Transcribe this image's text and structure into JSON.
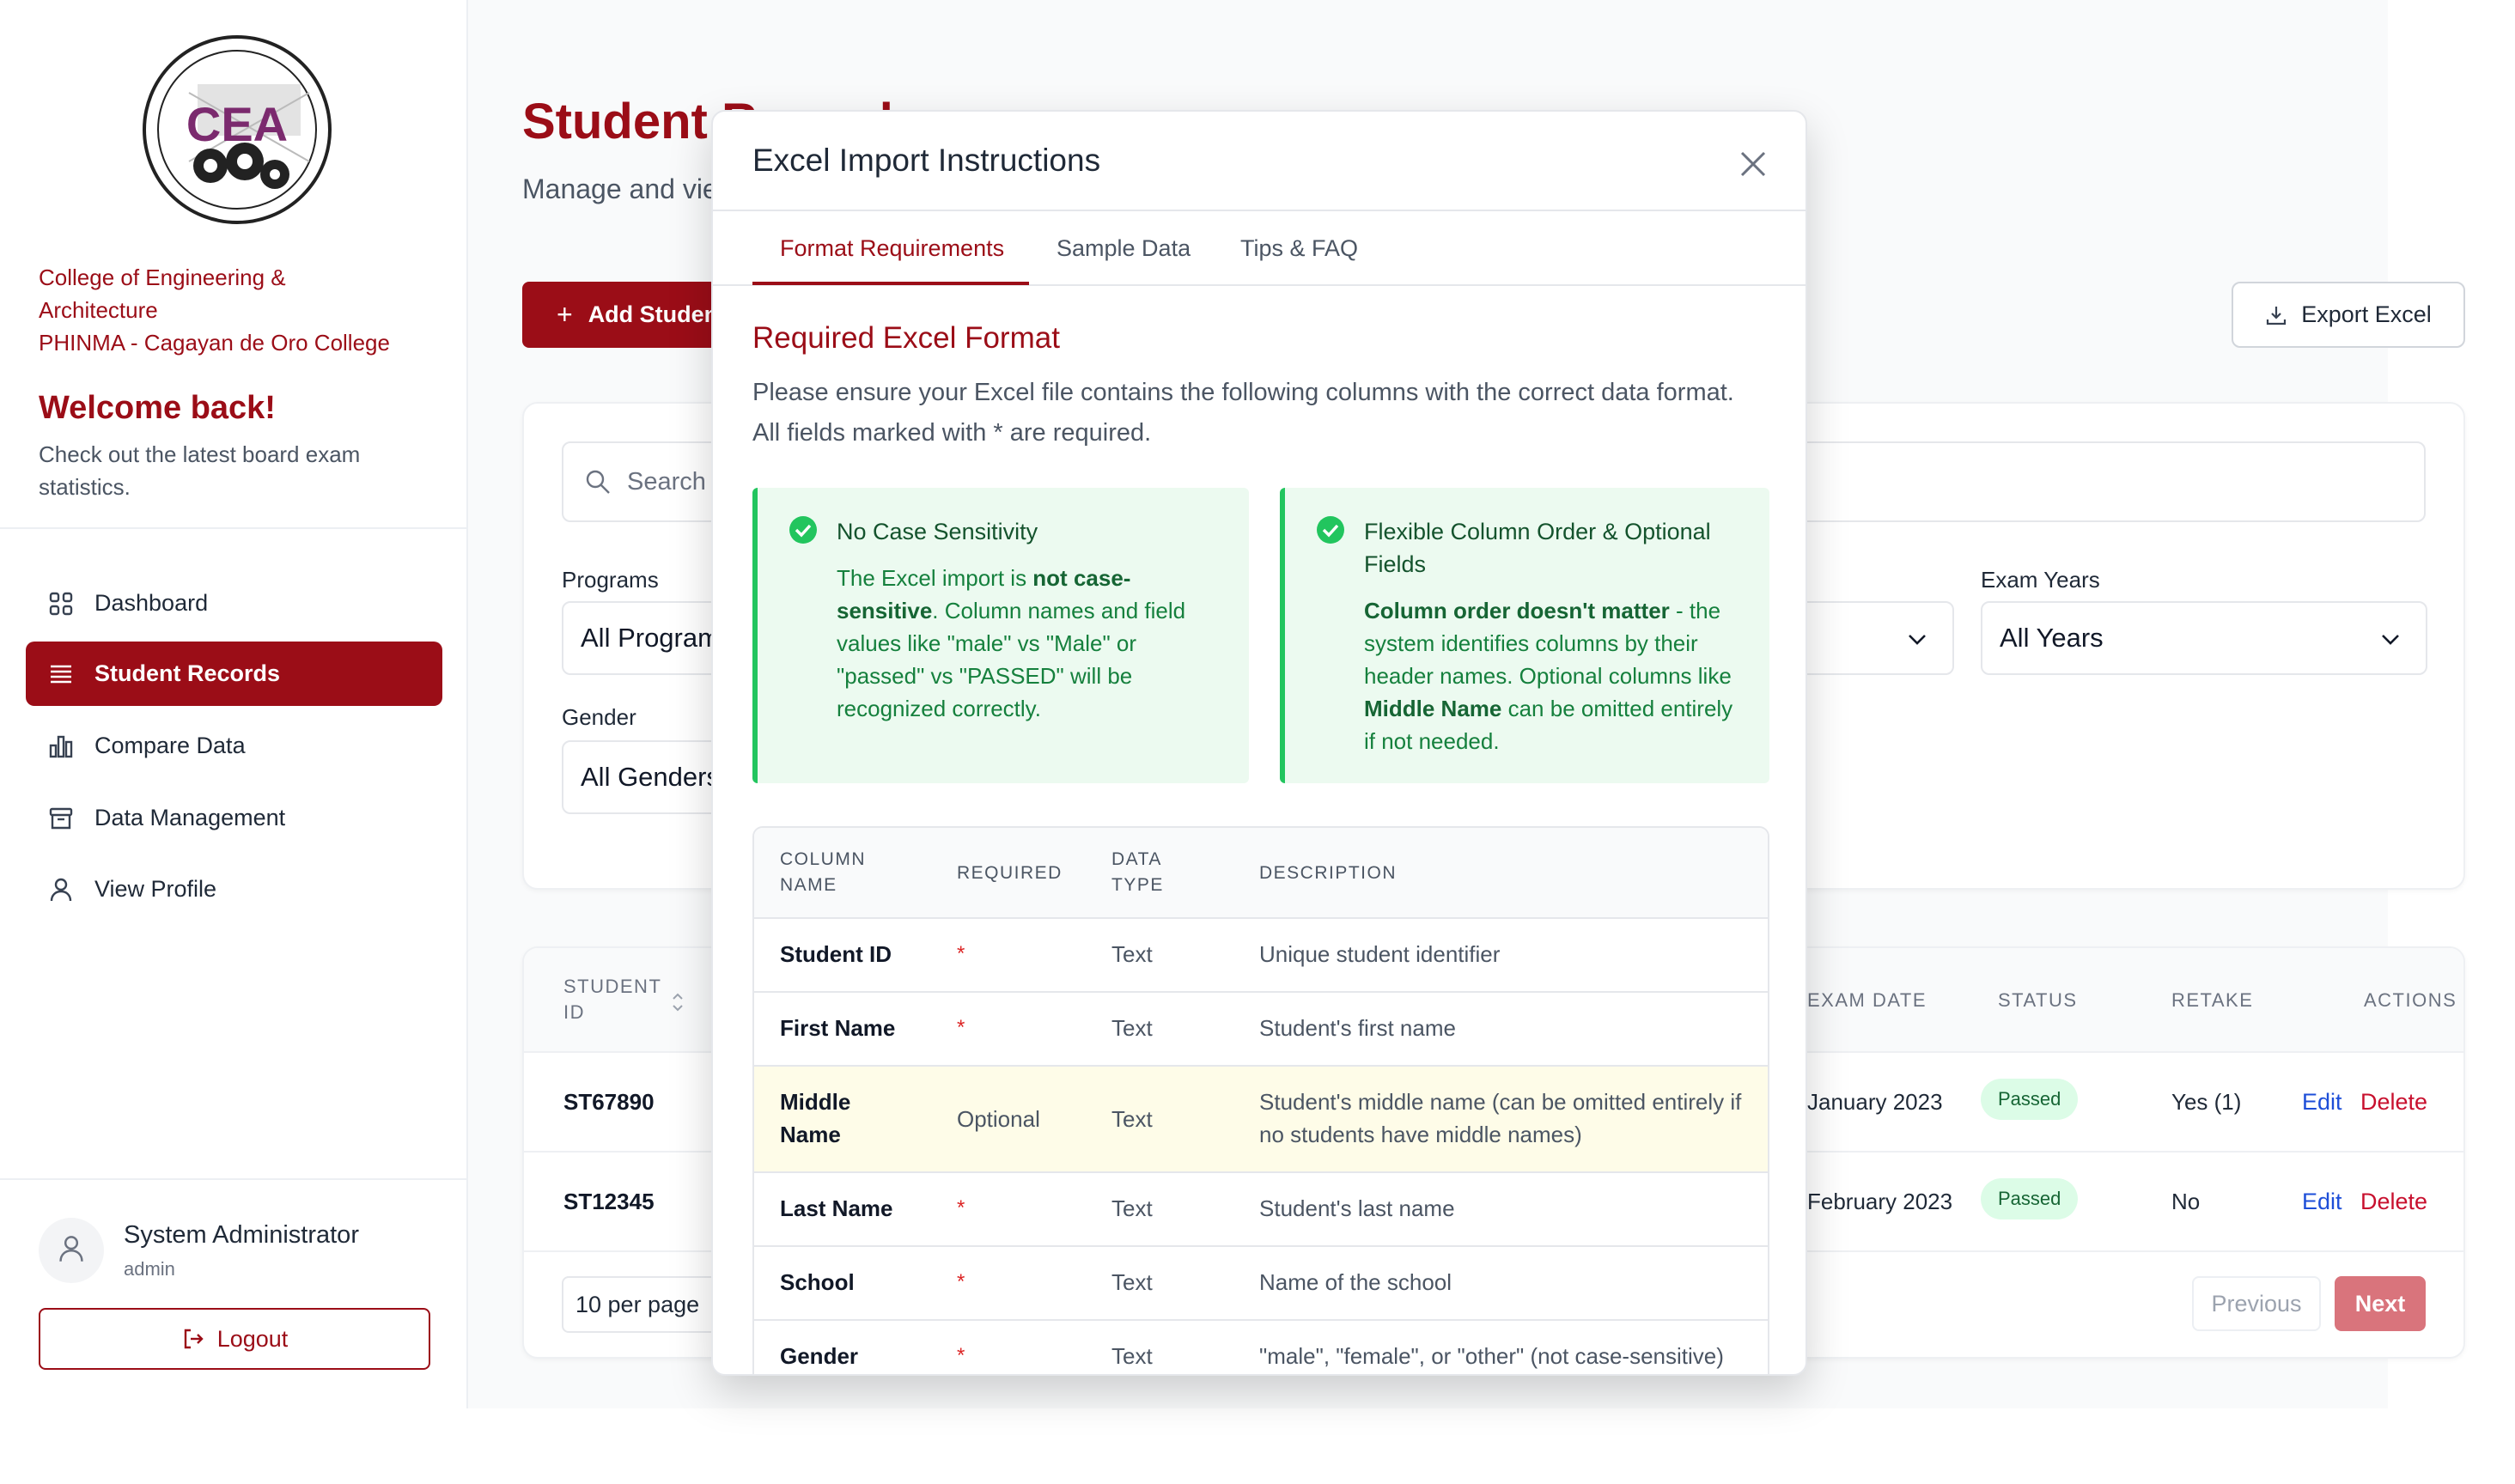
{
  "sidebar": {
    "college_lines": [
      "College of Engineering &",
      "Architecture",
      "PHINMA - Cagayan de Oro College"
    ],
    "logo_text": "CEA",
    "welcome": "Welcome back!",
    "welcome_sub": "Check out the latest board exam statistics.",
    "nav": [
      {
        "label": "Dashboard",
        "icon": "grid-icon"
      },
      {
        "label": "Student Records",
        "icon": "list-icon",
        "active": true
      },
      {
        "label": "Compare Data",
        "icon": "bar-chart-icon"
      },
      {
        "label": "Data Management",
        "icon": "archive-icon"
      },
      {
        "label": "View Profile",
        "icon": "user-icon"
      }
    ],
    "user": {
      "name": "System Administrator",
      "role": "admin"
    },
    "logout_label": "Logout"
  },
  "main": {
    "title": "Student Records",
    "subtitle": "Manage and view student records",
    "add_label": "Add Student",
    "export_label": "Export Excel",
    "search_placeholder": "Search",
    "filters": {
      "programs_label": "Programs",
      "programs_value": "All Programs",
      "gender_label": "Gender",
      "gender_value": "All Genders",
      "exam_years_label": "Exam Years",
      "exam_years_value": "All Years"
    },
    "table": {
      "headers": {
        "student_id": "STUDENT ID",
        "exam_date": "EXAM DATE",
        "status": "STATUS",
        "retake": "RETAKE",
        "actions": "ACTIONS"
      },
      "rows": [
        {
          "id": "ST67890",
          "date": "January 2023",
          "status": "Passed",
          "retake": "Yes (1)"
        },
        {
          "id": "ST12345",
          "date": "February 2023",
          "status": "Passed",
          "retake": "No"
        }
      ],
      "edit_label": "Edit",
      "delete_label": "Delete"
    },
    "per_page": "10 per page",
    "prev_label": "Previous",
    "next_label": "Next"
  },
  "modal": {
    "title": "Excel Import Instructions",
    "tabs": [
      "Format Requirements",
      "Sample Data",
      "Tips & FAQ"
    ],
    "section_title": "Required Excel Format",
    "section_desc": "Please ensure your Excel file contains the following columns with the correct data format. All fields marked with * are required.",
    "boxes": [
      {
        "title": "No Case Sensitivity",
        "p1": "The Excel import is ",
        "b1": "not case-sensitive",
        "p2": ". Column names and field values like \"male\" vs \"Male\" or \"passed\" vs \"PASSED\" will be recognized correctly."
      },
      {
        "title": "Flexible Column Order & Optional Fields",
        "b1": "Column order doesn't matter",
        "p1": " - the system identifies columns by their header names. Optional columns like ",
        "b2": "Middle Name",
        "p2": " can be omitted entirely if not needed."
      }
    ],
    "table_headers": {
      "column_name": "COLUMN NAME",
      "required": "REQUIRED",
      "data_type": "DATA TYPE",
      "description": "DESCRIPTION"
    },
    "rows": [
      {
        "name": "Student ID",
        "required": "*",
        "type": "Text",
        "desc": "Unique student identifier"
      },
      {
        "name": "First Name",
        "required": "*",
        "type": "Text",
        "desc": "Student's first name"
      },
      {
        "name": "Middle Name",
        "required": "Optional",
        "type": "Text",
        "desc": "Student's middle name (can be omitted entirely if no students have middle names)"
      },
      {
        "name": "Last Name",
        "required": "*",
        "type": "Text",
        "desc": "Student's last name"
      },
      {
        "name": "School",
        "required": "*",
        "type": "Text",
        "desc": "Name of the school"
      },
      {
        "name": "Gender",
        "required": "*",
        "type": "Text",
        "desc": "\"male\", \"female\", or \"other\" (not case-sensitive)"
      }
    ]
  },
  "colors": {
    "brand": "#9b0d17",
    "success": "#22c55e",
    "link": "#1d4ed8",
    "danger": "#c8102e"
  }
}
